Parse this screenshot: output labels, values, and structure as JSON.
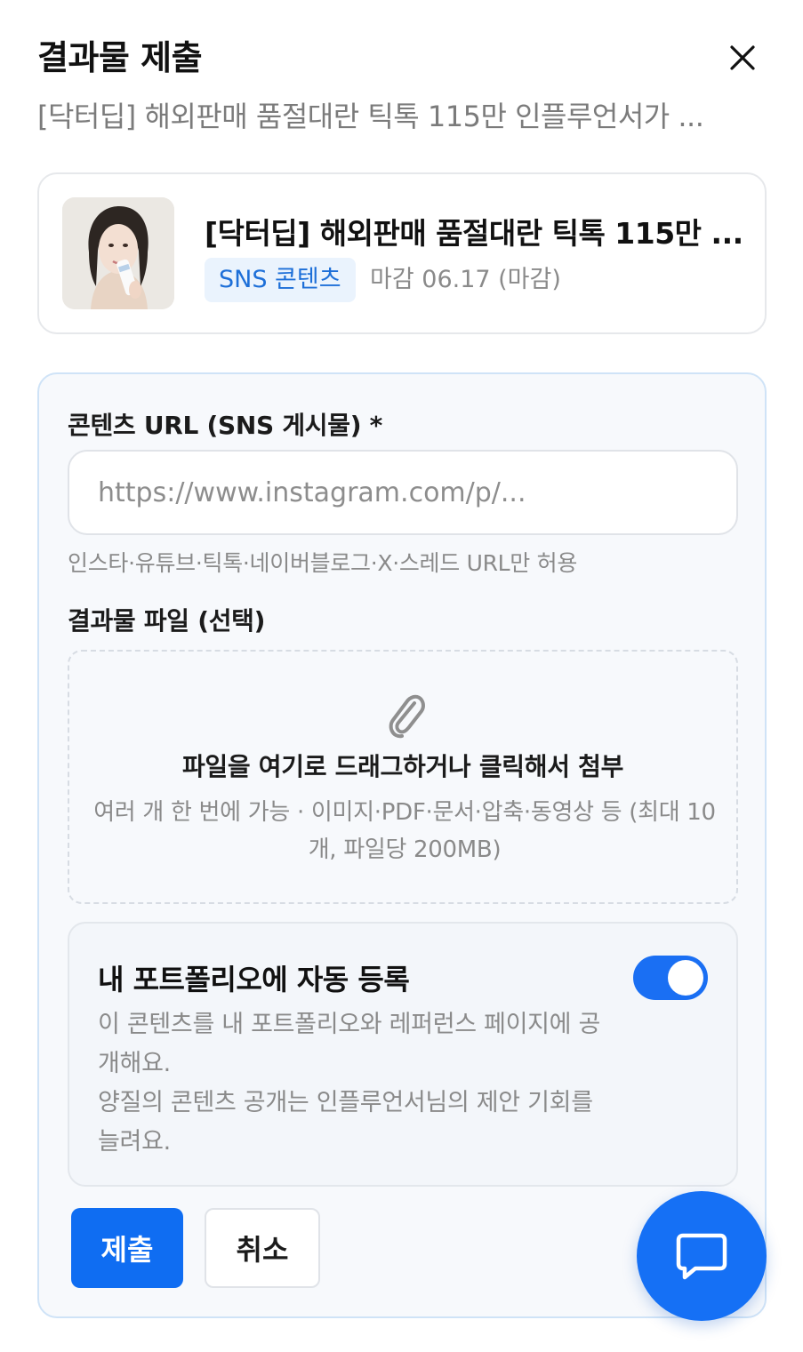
{
  "modal": {
    "title": "결과물 제출",
    "subtitle": "[닥터딥] 해외판매 품절대란 틱톡 115만 인플루언서가 ..."
  },
  "campaign": {
    "title": "[닥터딥] 해외판매 품절대란 틱톡 115만 ...",
    "tag": "SNS 콘텐츠",
    "deadline": "마감 06.17 (마감)"
  },
  "form": {
    "url_label": "콘텐츠 URL (SNS 게시물) *",
    "url_placeholder": "https://www.instagram.com/p/...",
    "url_value": "",
    "url_hint": "인스타·유튜브·틱톡·네이버블로그·X·스레드 URL만 허용",
    "file_label": "결과물 파일 (선택)",
    "dropzone_main": "파일을 여기로 드래그하거나 클릭해서 첨부",
    "dropzone_sub": "여러 개 한 번에 가능 · 이미지·PDF·문서·압축·동영상 등 (최대 10개, 파일당 200MB)"
  },
  "portfolio": {
    "title": "내 포트폴리오에 자동 등록",
    "desc_1": "이 콘텐츠를 내 포트폴리오와 레퍼런스 페이지에 공개해요.",
    "desc_2": "양질의 콘텐츠 공개는 인플루언서님의 제안 기회를 늘려요.",
    "toggle_on": true
  },
  "actions": {
    "submit_label": "제출",
    "cancel_label": "취소"
  },
  "icons": {
    "close": "close-icon",
    "attach": "paperclip-icon",
    "chat": "chat-bubble-icon"
  },
  "colors": {
    "primary": "#0f6df2",
    "tag_bg": "#eaf3fd",
    "tag_text": "#1d6fd8",
    "panel_border": "#cfe3f7"
  }
}
